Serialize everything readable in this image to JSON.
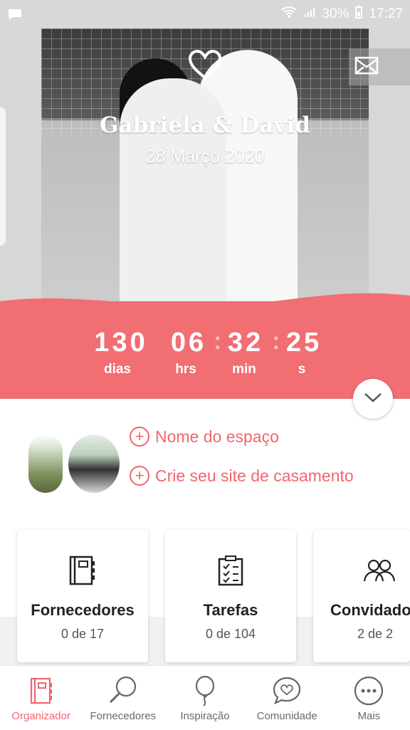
{
  "status_bar": {
    "battery": "30%",
    "time": "17:27"
  },
  "hero": {
    "names": "Gabriela & David",
    "date": "28 Março 2020"
  },
  "countdown": {
    "days": "130",
    "hours": "06",
    "minutes": "32",
    "seconds": "25",
    "days_label": "dias",
    "hours_label": "hrs",
    "minutes_label": "min",
    "seconds_label": "s"
  },
  "links": [
    {
      "label": "Nome do espaço"
    },
    {
      "label": "Crie seu site de casamento"
    }
  ],
  "cards": [
    {
      "title": "Fornecedores",
      "count": "0 de 17",
      "icon": "notebook-icon"
    },
    {
      "title": "Tarefas",
      "count": "0 de 104",
      "icon": "checklist-icon"
    },
    {
      "title": "Convidados",
      "count": "2 de 2",
      "icon": "guests-icon"
    }
  ],
  "bottom_nav": [
    {
      "label": "Organizador",
      "icon": "organizer-icon",
      "active": true
    },
    {
      "label": "Fornecedores",
      "icon": "search-icon",
      "active": false
    },
    {
      "label": "Inspiração",
      "icon": "balloon-icon",
      "active": false
    },
    {
      "label": "Comunidade",
      "icon": "chat-heart-icon",
      "active": false
    },
    {
      "label": "Mais",
      "icon": "more-icon",
      "active": false
    }
  ],
  "colors": {
    "accent": "#f16e73",
    "status_bar": "#d8d8d8"
  }
}
